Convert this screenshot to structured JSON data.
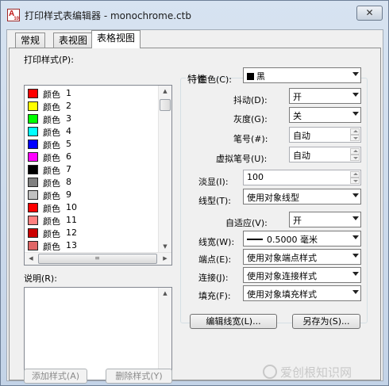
{
  "window": {
    "title": "打印样式表编辑器 - monochrome.ctb",
    "app_icon_letters": "A",
    "app_icon_version": "10",
    "close_glyph": "✕"
  },
  "tabs": [
    {
      "label": "常规",
      "active": false
    },
    {
      "label": "表视图",
      "active": false
    },
    {
      "label": "表格视图",
      "active": true
    }
  ],
  "styles_list": {
    "label": "打印样式(P):",
    "items": [
      {
        "name": "颜色",
        "num": "1",
        "color": "#ff0000"
      },
      {
        "name": "颜色",
        "num": "2",
        "color": "#ffff00"
      },
      {
        "name": "颜色",
        "num": "3",
        "color": "#00ff00"
      },
      {
        "name": "颜色",
        "num": "4",
        "color": "#00ffff"
      },
      {
        "name": "颜色",
        "num": "5",
        "color": "#0000ff"
      },
      {
        "name": "颜色",
        "num": "6",
        "color": "#ff00ff"
      },
      {
        "name": "颜色",
        "num": "7",
        "color": "#000000"
      },
      {
        "name": "颜色",
        "num": "8",
        "color": "#808080"
      },
      {
        "name": "颜色",
        "num": "9",
        "color": "#c0c0c0"
      },
      {
        "name": "颜色",
        "num": "10",
        "color": "#ff0000"
      },
      {
        "name": "颜色",
        "num": "11",
        "color": "#ff8080"
      },
      {
        "name": "颜色",
        "num": "12",
        "color": "#cc0000"
      },
      {
        "name": "颜色",
        "num": "13",
        "color": "#e06666"
      }
    ],
    "scroll_up": "▲",
    "scroll_down": "▼",
    "scroll_left": "◀",
    "scroll_right": "▶",
    "h_thumb_grip": "≡"
  },
  "description": {
    "label": "说明(R):"
  },
  "buttons": {
    "add_style": "添加样式(A)",
    "delete_style": "删除样式(Y)",
    "edit_lineweights": "编辑线宽(L)...",
    "save_as": "另存为(S)..."
  },
  "properties": {
    "group_label": "特性",
    "color": {
      "label": "颜色(C):",
      "value": "黑"
    },
    "dither": {
      "label": "抖动(D):",
      "value": "开"
    },
    "grayscale": {
      "label": "灰度(G):",
      "value": "关"
    },
    "pen": {
      "label": "笔号(#):",
      "value": "自动"
    },
    "virtual_pen": {
      "label": "虚拟笔号(U):",
      "value": "自动"
    },
    "screening": {
      "label": "淡显(I):",
      "value": "100"
    },
    "linetype": {
      "label": "线型(T):",
      "value": "使用对象线型"
    },
    "adaptive": {
      "label": "自适应(V):",
      "value": "开"
    },
    "lineweight": {
      "label": "线宽(W):",
      "value": "0.5000 毫米"
    },
    "line_end": {
      "label": "端点(E):",
      "value": "使用对象端点样式"
    },
    "line_join": {
      "label": "连接(J):",
      "value": "使用对象连接样式"
    },
    "fill": {
      "label": "填充(F):",
      "value": "使用对象填充样式"
    }
  },
  "watermark": {
    "text": "爱创根知识网"
  }
}
